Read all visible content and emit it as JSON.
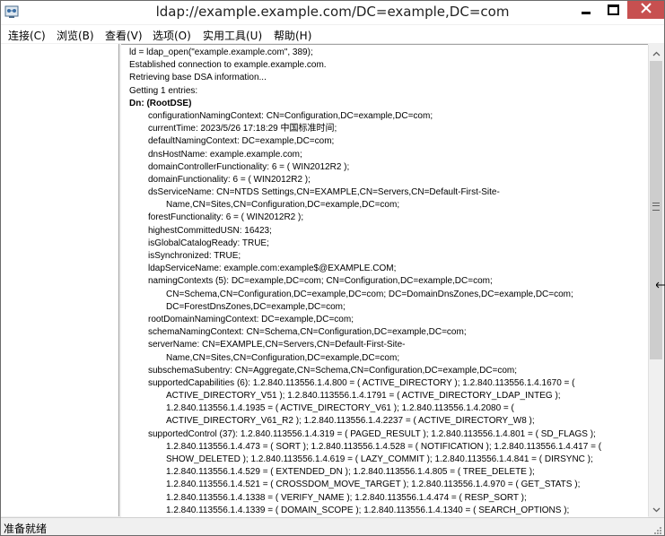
{
  "window": {
    "title": "ldap://example.example.com/DC=example,DC=com"
  },
  "menu": [
    {
      "label": "连接(C)"
    },
    {
      "label": "浏览(B)"
    },
    {
      "label": "查看(V)"
    },
    {
      "label": "选项(O)"
    },
    {
      "label": "实用工具(U)"
    },
    {
      "label": "帮助(H)"
    }
  ],
  "log": {
    "lines": [
      {
        "text": "ld = ldap_open(\"example.example.com\", 389);",
        "indent": 0
      },
      {
        "text": "Established connection to example.example.com.",
        "indent": 0
      },
      {
        "text": "Retrieving base DSA information...",
        "indent": 0
      },
      {
        "text": "Getting 1 entries:",
        "indent": 0
      },
      {
        "text": "Dn: (RootDSE)",
        "indent": 0,
        "bold": true
      },
      {
        "text": "configurationNamingContext: CN=Configuration,DC=example,DC=com;",
        "indent": 1
      },
      {
        "text": "currentTime: 2023/5/26 17:18:29 中国标准时间;",
        "indent": 1
      },
      {
        "text": "defaultNamingContext: DC=example,DC=com;",
        "indent": 1
      },
      {
        "text": "dnsHostName: example.example.com;",
        "indent": 1
      },
      {
        "text": "domainControllerFunctionality: 6 = ( WIN2012R2 );",
        "indent": 1
      },
      {
        "text": "domainFunctionality: 6 = ( WIN2012R2 );",
        "indent": 1
      },
      {
        "text": "dsServiceName: CN=NTDS Settings,CN=EXAMPLE,CN=Servers,CN=Default-First-Site-",
        "indent": 1
      },
      {
        "text": "Name,CN=Sites,CN=Configuration,DC=example,DC=com;",
        "indent": 2
      },
      {
        "text": "forestFunctionality: 6 = ( WIN2012R2 );",
        "indent": 1
      },
      {
        "text": "highestCommittedUSN: 16423;",
        "indent": 1
      },
      {
        "text": "isGlobalCatalogReady: TRUE;",
        "indent": 1
      },
      {
        "text": "isSynchronized: TRUE;",
        "indent": 1
      },
      {
        "text": "ldapServiceName: example.com:example$@EXAMPLE.COM;",
        "indent": 1
      },
      {
        "text": "namingContexts (5): DC=example,DC=com; CN=Configuration,DC=example,DC=com;",
        "indent": 1
      },
      {
        "text": "CN=Schema,CN=Configuration,DC=example,DC=com; DC=DomainDnsZones,DC=example,DC=com;",
        "indent": 2
      },
      {
        "text": "DC=ForestDnsZones,DC=example,DC=com;",
        "indent": 2
      },
      {
        "text": "rootDomainNamingContext: DC=example,DC=com;",
        "indent": 1
      },
      {
        "text": "schemaNamingContext: CN=Schema,CN=Configuration,DC=example,DC=com;",
        "indent": 1
      },
      {
        "text": "serverName: CN=EXAMPLE,CN=Servers,CN=Default-First-Site-",
        "indent": 1
      },
      {
        "text": "Name,CN=Sites,CN=Configuration,DC=example,DC=com;",
        "indent": 2
      },
      {
        "text": "subschemaSubentry: CN=Aggregate,CN=Schema,CN=Configuration,DC=example,DC=com;",
        "indent": 1
      },
      {
        "text": "supportedCapabilities (6): 1.2.840.113556.1.4.800 = ( ACTIVE_DIRECTORY ); 1.2.840.113556.1.4.1670 = (",
        "indent": 1
      },
      {
        "text": "ACTIVE_DIRECTORY_V51 ); 1.2.840.113556.1.4.1791 = ( ACTIVE_DIRECTORY_LDAP_INTEG );",
        "indent": 2
      },
      {
        "text": "1.2.840.113556.1.4.1935 = ( ACTIVE_DIRECTORY_V61 ); 1.2.840.113556.1.4.2080 = (",
        "indent": 2
      },
      {
        "text": "ACTIVE_DIRECTORY_V61_R2 ); 1.2.840.113556.1.4.2237 = ( ACTIVE_DIRECTORY_W8 );",
        "indent": 2
      },
      {
        "text": "supportedControl (37): 1.2.840.113556.1.4.319 = ( PAGED_RESULT ); 1.2.840.113556.1.4.801 = ( SD_FLAGS );",
        "indent": 1
      },
      {
        "text": "1.2.840.113556.1.4.473 = ( SORT ); 1.2.840.113556.1.4.528 = ( NOTIFICATION ); 1.2.840.113556.1.4.417 = (",
        "indent": 2
      },
      {
        "text": "SHOW_DELETED ); 1.2.840.113556.1.4.619 = ( LAZY_COMMIT ); 1.2.840.113556.1.4.841 = ( DIRSYNC );",
        "indent": 2
      },
      {
        "text": "1.2.840.113556.1.4.529 = ( EXTENDED_DN ); 1.2.840.113556.1.4.805 = ( TREE_DELETE );",
        "indent": 2
      },
      {
        "text": "1.2.840.113556.1.4.521 = ( CROSSDOM_MOVE_TARGET ); 1.2.840.113556.1.4.970 = ( GET_STATS );",
        "indent": 2
      },
      {
        "text": "1.2.840.113556.1.4.1338 = ( VERIFY_NAME ); 1.2.840.113556.1.4.474 = ( RESP_SORT );",
        "indent": 2
      },
      {
        "text": "1.2.840.113556.1.4.1339 = ( DOMAIN_SCOPE ); 1.2.840.113556.1.4.1340 = ( SEARCH_OPTIONS );",
        "indent": 2
      }
    ]
  },
  "status": {
    "text": "准备就绪"
  },
  "colors": {
    "close_button": "#c75050",
    "scroll_thumb": "#cdcdcd"
  },
  "icons": [
    "app-icon",
    "minimize-icon",
    "maximize-icon",
    "close-icon",
    "scroll-up-icon",
    "scroll-down-icon",
    "size-grip-icon"
  ]
}
